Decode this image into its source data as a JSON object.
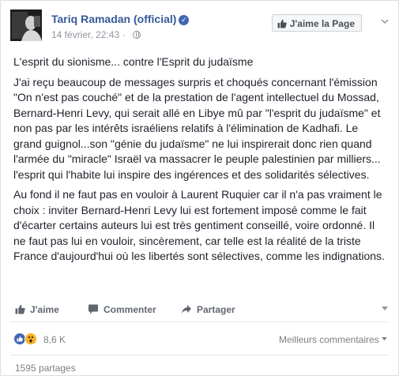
{
  "post": {
    "author": "Tariq Ramadan (official)",
    "timestamp": "14 février, 22:43",
    "like_page_label": "J'aime la Page",
    "paragraphs": [
      "L'esprit du sionisme... contre l'Esprit du judaïsme",
      "J'ai reçu beaucoup de messages surpris et choqués concernant l'émission \"On n'est pas couché\" et de la prestation de l'agent intellectuel du Mossad, Bernard-Henri Levy, qui serait allé en Libye mû par \"l'esprit du judaïsme\" et non pas par les intérêts israéliens relatifs à l'élimination de Kadhafi. Le grand guignol...son \"génie du judaïsme\" ne lui inspirerait donc rien quand l'armée du \"miracle\" Israël va massacrer le peuple palestinien par milliers... l'esprit qui l'habite lui inspire des ingérences et des solidarités sélectives.",
      "Au fond il ne faut pas en vouloir à Laurent Ruquier car il n'a pas vraiment le choix : inviter Bernard-Henri Levy lui est fortement imposé comme le fait d'écarter certains auteurs lui est très gentiment conseillé, voire ordonné. Il ne faut pas lui en vouloir, sincèrement, car telle est la réalité de la triste France d'aujourd'hui où les libertés sont sélectives, comme les indignations."
    ]
  },
  "actions": {
    "like": "J'aime",
    "comment": "Commenter",
    "share": "Partager"
  },
  "reactions": {
    "count": "8,6 K",
    "sort_label": "Meilleurs commentaires",
    "shares": "1595 partages"
  },
  "icons": {
    "verified": "verified-badge-icon",
    "audience": "globe-icon",
    "like": "thumbs-up-icon",
    "comment": "comment-bubble-icon",
    "share": "share-arrow-icon",
    "reaction_like": "like-reaction-icon",
    "reaction_wow": "wow-reaction-icon"
  },
  "colors": {
    "link": "#365899",
    "accent": "#4267b2",
    "muted": "#90949c"
  }
}
